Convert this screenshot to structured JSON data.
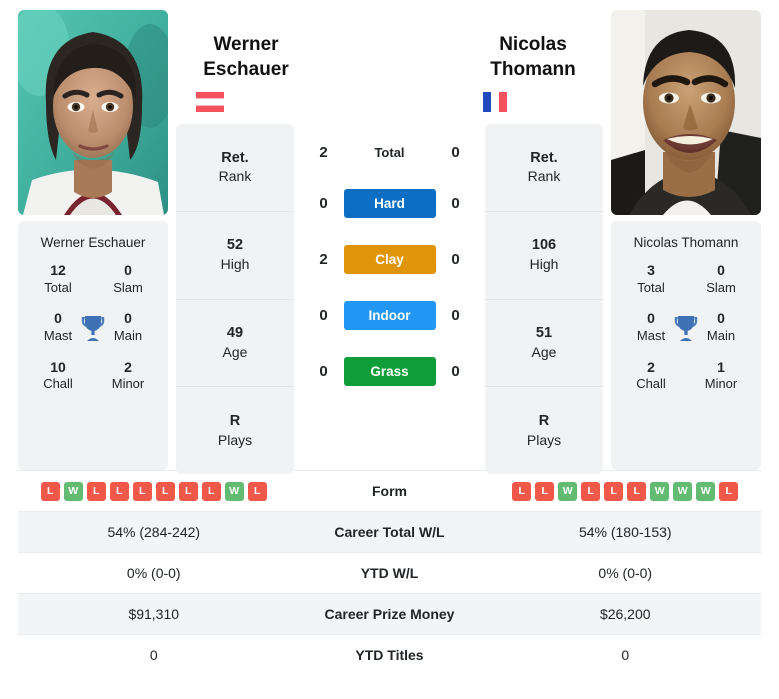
{
  "players": {
    "left": {
      "name": "Werner Eschauer",
      "name_line1": "Werner",
      "name_line2": "Eschauer",
      "country": "Austria",
      "flag": "austria-flag",
      "rank": "Ret.",
      "rank_label": "Rank",
      "high": "52",
      "high_label": "High",
      "age": "49",
      "age_label": "Age",
      "plays": "R",
      "plays_label": "Plays",
      "titles": {
        "total": "12",
        "total_label": "Total",
        "slam": "0",
        "slam_label": "Slam",
        "mast": "0",
        "mast_label": "Mast",
        "main": "0",
        "main_label": "Main",
        "chall": "10",
        "chall_label": "Chall",
        "minor": "2",
        "minor_label": "Minor"
      },
      "h2h": {
        "total": "2",
        "hard": "0",
        "clay": "2",
        "indoor": "0",
        "grass": "0"
      },
      "form": [
        "L",
        "W",
        "L",
        "L",
        "L",
        "L",
        "L",
        "L",
        "W",
        "L"
      ],
      "career_wl": "54% (284-242)",
      "ytd_wl": "0% (0-0)",
      "prize_money": "$91,310",
      "ytd_titles": "0"
    },
    "right": {
      "name": "Nicolas Thomann",
      "name_line1": "Nicolas",
      "name_line2": "Thomann",
      "country": "France",
      "flag": "france-flag",
      "rank": "Ret.",
      "rank_label": "Rank",
      "high": "106",
      "high_label": "High",
      "age": "51",
      "age_label": "Age",
      "plays": "R",
      "plays_label": "Plays",
      "titles": {
        "total": "3",
        "total_label": "Total",
        "slam": "0",
        "slam_label": "Slam",
        "mast": "0",
        "mast_label": "Mast",
        "main": "0",
        "main_label": "Main",
        "chall": "2",
        "chall_label": "Chall",
        "minor": "1",
        "minor_label": "Minor"
      },
      "h2h": {
        "total": "0",
        "hard": "0",
        "clay": "0",
        "indoor": "0",
        "grass": "0"
      },
      "form": [
        "L",
        "L",
        "W",
        "L",
        "L",
        "L",
        "W",
        "W",
        "W",
        "L"
      ],
      "career_wl": "54% (180-153)",
      "ytd_wl": "0% (0-0)",
      "prize_money": "$26,200",
      "ytd_titles": "0"
    }
  },
  "surfaces": [
    {
      "key": "total",
      "label": "Total",
      "color": "transparent",
      "text_color": "#212529"
    },
    {
      "key": "hard",
      "label": "Hard",
      "color": "#0c6fc4",
      "text_color": "#ffffff"
    },
    {
      "key": "clay",
      "label": "Clay",
      "color": "#e0940a",
      "text_color": "#ffffff"
    },
    {
      "key": "indoor",
      "label": "Indoor",
      "color": "#2196f3",
      "text_color": "#ffffff"
    },
    {
      "key": "grass",
      "label": "Grass",
      "color": "#0f9d3a",
      "text_color": "#ffffff"
    }
  ],
  "table_labels": {
    "form": "Form",
    "career_wl": "Career Total W/L",
    "ytd_wl": "YTD W/L",
    "prize_money": "Career Prize Money",
    "ytd_titles": "YTD Titles"
  },
  "colors": {
    "win": "#63bb72",
    "loss": "#f0584a",
    "card_bg": "#f1f2f3",
    "row_alt": "#f3f4f5",
    "trophy": "#3f72b5",
    "austria_red": "#f4525e",
    "france_blue": "#1f4bbf",
    "france_red": "#f4525e"
  }
}
